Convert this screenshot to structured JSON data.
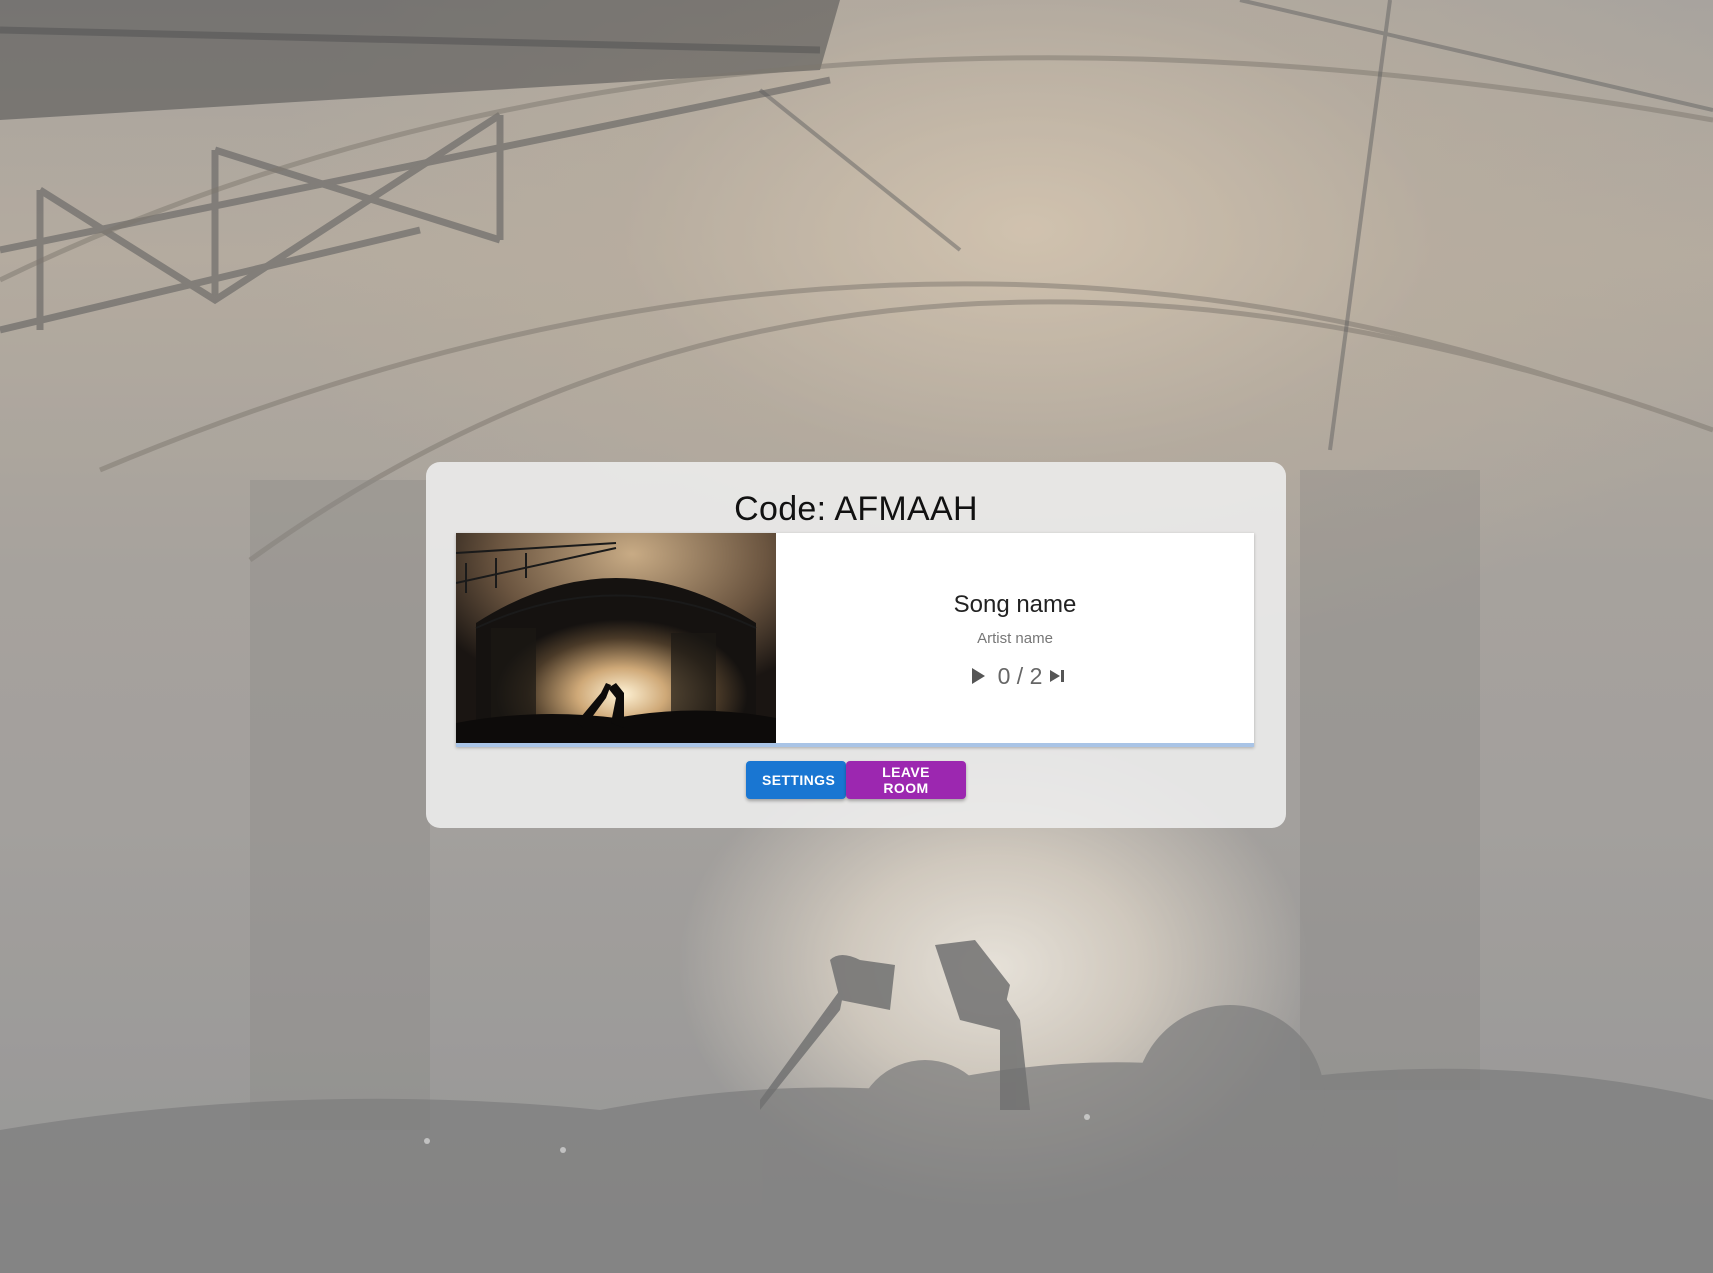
{
  "room": {
    "code_label": "Code:",
    "code": "AFMAAH"
  },
  "player": {
    "song_name": "Song name",
    "artist_name": "Artist name",
    "votes": "0 / 2",
    "progress_fraction": 0,
    "play_icon": "play-icon",
    "skip_icon": "skip-next-icon"
  },
  "actions": {
    "settings_label": "SETTINGS",
    "leave_label": "LEAVE ROOM"
  },
  "colors": {
    "settings_button": "#1976d2",
    "leave_button": "#9c27b0",
    "progress_track": "#a9c4e6"
  }
}
